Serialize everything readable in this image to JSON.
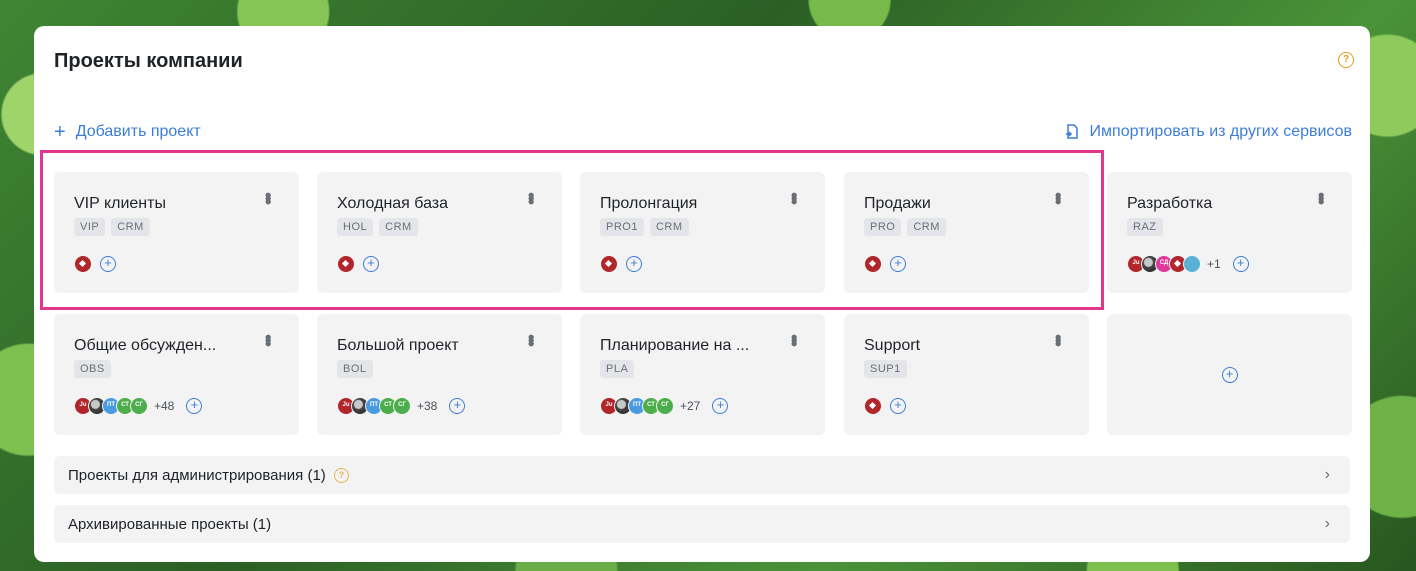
{
  "header": {
    "title": "Проекты компании",
    "help_icon": "question-circle-icon"
  },
  "actions": {
    "add_project": "Добавить проект",
    "import": "Импортировать из других сервисов"
  },
  "projects": [
    {
      "name": "VIP клиенты",
      "tags": [
        "VIP",
        "CRM"
      ],
      "members": [
        "ticket"
      ],
      "more": ""
    },
    {
      "name": "Холодная база",
      "tags": [
        "HOL",
        "CRM"
      ],
      "members": [
        "ticket"
      ],
      "more": ""
    },
    {
      "name": "Пролонгация",
      "tags": [
        "PRO1",
        "CRM"
      ],
      "members": [
        "ticket"
      ],
      "more": ""
    },
    {
      "name": "Продажи",
      "tags": [
        "PRO",
        "CRM"
      ],
      "members": [
        "ticket"
      ],
      "more": ""
    },
    {
      "name": "Разработка",
      "tags": [
        "RAZ"
      ],
      "members": [
        "Ju",
        "photo",
        "СД",
        "ticket",
        "photo2"
      ],
      "more": "+1"
    },
    {
      "name": "Общие обсужден...",
      "tags": [
        "OBS"
      ],
      "members": [
        "Ju",
        "photo",
        "ПТ",
        "СТ",
        "СГ"
      ],
      "more": "+48"
    },
    {
      "name": "Большой проект",
      "tags": [
        "BOL"
      ],
      "members": [
        "Ju",
        "photo",
        "ПТ",
        "СТ",
        "СГ"
      ],
      "more": "+38"
    },
    {
      "name": "Планирование на ...",
      "tags": [
        "PLA"
      ],
      "members": [
        "Ju",
        "photo",
        "ПТ",
        "СТ",
        "СГ"
      ],
      "more": "+27"
    },
    {
      "name": "Support",
      "tags": [
        "SUP1"
      ],
      "members": [
        "ticket"
      ],
      "more": ""
    }
  ],
  "sections": [
    {
      "label": "Проекты для администрирования (1)",
      "has_help": true
    },
    {
      "label": "Архивированные проекты (1)",
      "has_help": false
    }
  ]
}
